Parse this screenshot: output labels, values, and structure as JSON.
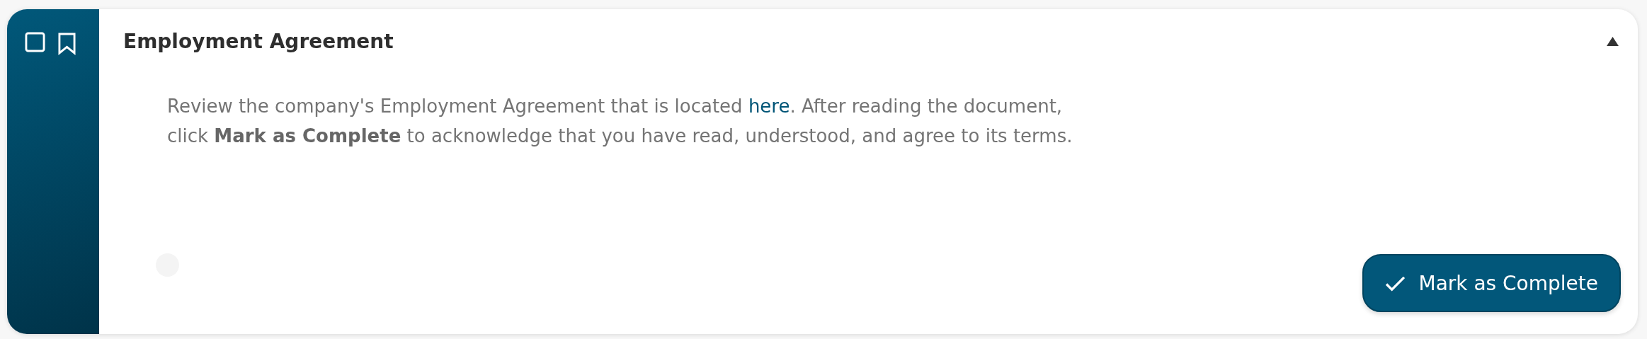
{
  "task": {
    "checked": false,
    "bookmarked": false,
    "title": "Employment Agreement",
    "expanded": true,
    "description": {
      "before": "Review the company's Employment Agreement that is located ",
      "link": "here",
      "after": ". After reading the document,",
      "line_2": "click **Mark as Complete** to acknowledge that you have read, understood, and agree to its terms."
    },
    "button": "Mark as Complete"
  }
}
